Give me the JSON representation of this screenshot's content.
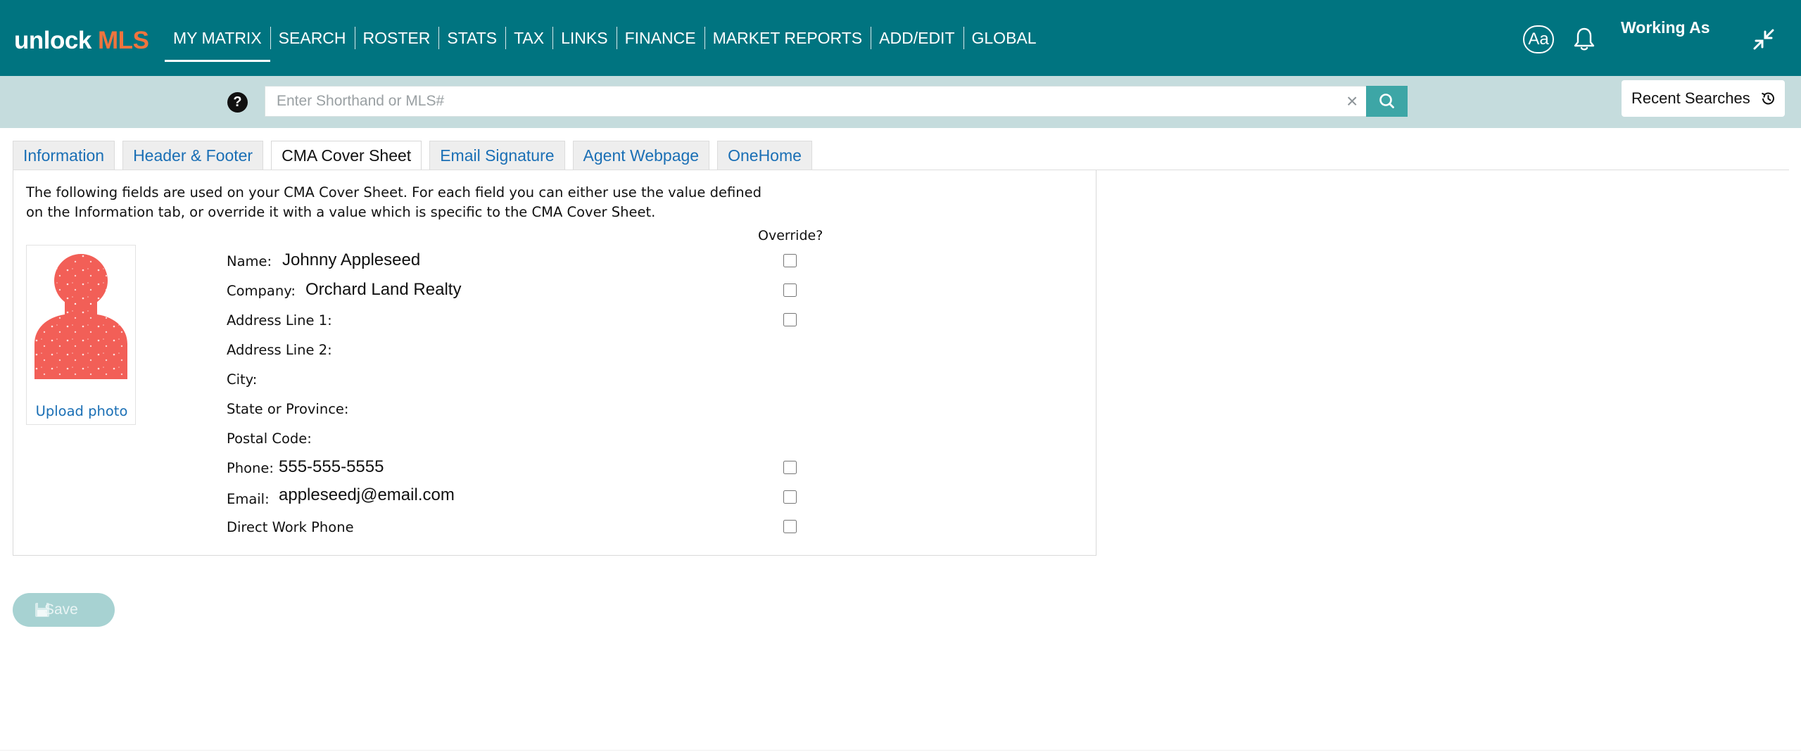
{
  "app": {
    "logo_part1": "unlock",
    "logo_part2": "MLS",
    "brand_color": "#007480",
    "accent_color": "#f0743e"
  },
  "nav": {
    "items": [
      {
        "label": "MY MATRIX",
        "active": true
      },
      {
        "label": "SEARCH"
      },
      {
        "label": "ROSTER"
      },
      {
        "label": "STATS"
      },
      {
        "label": "TAX"
      },
      {
        "label": "LINKS"
      },
      {
        "label": "FINANCE"
      },
      {
        "label": "MARKET REPORTS"
      },
      {
        "label": "ADD/EDIT"
      },
      {
        "label": "GLOBAL"
      }
    ],
    "text_size_button": "Aa",
    "working_as": "Working As",
    "icons": [
      "bell-icon",
      "collapse-arrows-icon"
    ]
  },
  "search": {
    "help_icon": "?",
    "placeholder": "Enter Shorthand or MLS#",
    "value": "",
    "clear_icon": "×",
    "recent_searches_label": "Recent Searches"
  },
  "tabs": [
    {
      "label": "Information"
    },
    {
      "label": "Header & Footer"
    },
    {
      "label": "CMA Cover Sheet",
      "active": true
    },
    {
      "label": "Email Signature"
    },
    {
      "label": "Agent Webpage"
    },
    {
      "label": "OneHome"
    }
  ],
  "panel": {
    "intro_line1": "The following fields are used on your CMA Cover Sheet. For each field you can either use the value defined",
    "intro_line2": "on the Information tab, or override it with a value which is specific to the CMA Cover Sheet.",
    "override_header": "Override?",
    "upload_photo": "Upload photo",
    "fields": {
      "name": {
        "label": "Name:",
        "value": "Johnny Appleseed",
        "override": false
      },
      "company": {
        "label": "Company:",
        "value": "Orchard Land Realty",
        "override": false
      },
      "address1": {
        "label": "Address Line 1:",
        "value": "",
        "override": false
      },
      "address2": {
        "label": "Address Line 2:",
        "value": ""
      },
      "city": {
        "label": "City:",
        "value": ""
      },
      "state": {
        "label": "State or Province:",
        "value": ""
      },
      "postal": {
        "label": "Postal Code:",
        "value": ""
      },
      "phone": {
        "label": "Phone:",
        "value": "555-555-5555",
        "override": false
      },
      "email": {
        "label": "Email:",
        "value": "appleseedj@email.com",
        "override": false
      },
      "direct": {
        "label": "Direct Work Phone",
        "value": "",
        "override": false
      }
    }
  },
  "actions": {
    "save_label": "Save"
  }
}
